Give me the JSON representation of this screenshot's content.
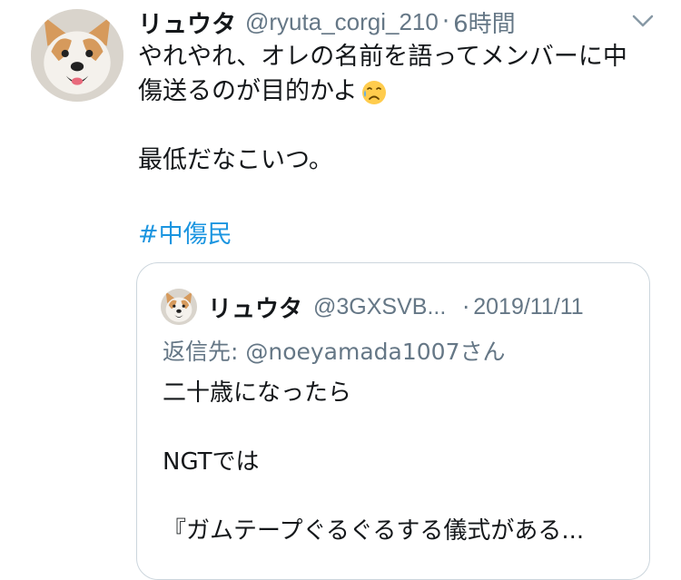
{
  "tweet": {
    "display_name": "リュウタ",
    "handle": "@ryuta_corgi_210",
    "separator": "·",
    "time": "6時間",
    "menu_icon": "chevron-down-icon",
    "avatar_icon": "dog-avatar",
    "text_line1": "やれやれ、オレの名前を語ってメンバーに中",
    "text_line2": "傷送るのが目的かよ",
    "emoji": "sad-relieved-face-emoji",
    "text_line3": "最低だなこいつ。",
    "hashtag": "#中傷民"
  },
  "quote": {
    "display_name": "リュウタ",
    "handle": "@3GXSVB...",
    "separator": "·",
    "date": "2019/11/11",
    "reply_to": "返信先: @noeyamada1007さん",
    "line1": "二十歳になったら",
    "line2": "NGTでは",
    "line3": "『ガムテープぐるぐるする儀式がある..."
  },
  "colors": {
    "text": "#14171a",
    "secondary": "#657786",
    "link": "#1b95e0",
    "border": "#ccd6dd"
  }
}
